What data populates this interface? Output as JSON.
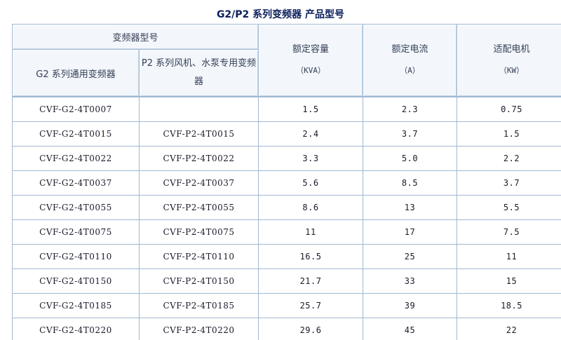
{
  "page": {
    "title": "G2/P2 系列变频器 产品型号"
  },
  "table": {
    "group_header": "变频器型号",
    "headers": {
      "g2": "G2 系列通用变频器",
      "p2": "P2 系列风机、水泵专用变频器",
      "capacity": "额定容量",
      "capacity_unit": "（KVA）",
      "current": "额定电流",
      "current_unit": "（A）",
      "motor": "适配电机",
      "motor_unit": "（KW）"
    },
    "rows": [
      {
        "g2": "CVF-G2-4T0007",
        "p2": "",
        "capacity": "1.5",
        "current": "2.3",
        "motor": "0.75"
      },
      {
        "g2": "CVF-G2-4T0015",
        "p2": "CVF-P2-4T0015",
        "capacity": "2.4",
        "current": "3.7",
        "motor": "1.5"
      },
      {
        "g2": "CVF-G2-4T0022",
        "p2": "CVF-P2-4T0022",
        "capacity": "3.3",
        "current": "5.0",
        "motor": "2.2"
      },
      {
        "g2": "CVF-G2-4T0037",
        "p2": "CVF-P2-4T0037",
        "capacity": "5.6",
        "current": "8.5",
        "motor": "3.7"
      },
      {
        "g2": "CVF-G2-4T0055",
        "p2": "CVF-P2-4T0055",
        "capacity": "8.6",
        "current": "13",
        "motor": "5.5"
      },
      {
        "g2": "CVF-G2-4T0075",
        "p2": "CVF-P2-4T0075",
        "capacity": "11",
        "current": "17",
        "motor": "7.5"
      },
      {
        "g2": "CVF-G2-4T0110",
        "p2": "CVF-P2-4T0110",
        "capacity": "16.5",
        "current": "25",
        "motor": "11"
      },
      {
        "g2": "CVF-G2-4T0150",
        "p2": "CVF-P2-4T0150",
        "capacity": "21.7",
        "current": "33",
        "motor": "15"
      },
      {
        "g2": "CVF-G2-4T0185",
        "p2": "CVF-P2-4T0185",
        "capacity": "25.7",
        "current": "39",
        "motor": "18.5"
      },
      {
        "g2": "CVF-G2-4T0220",
        "p2": "CVF-P2-4T0220",
        "capacity": "29.6",
        "current": "45",
        "motor": "22"
      }
    ]
  },
  "colors": {
    "title": "#0a1f5c",
    "header_bg": "#f3f6fb",
    "border": "#9fb9d3"
  }
}
